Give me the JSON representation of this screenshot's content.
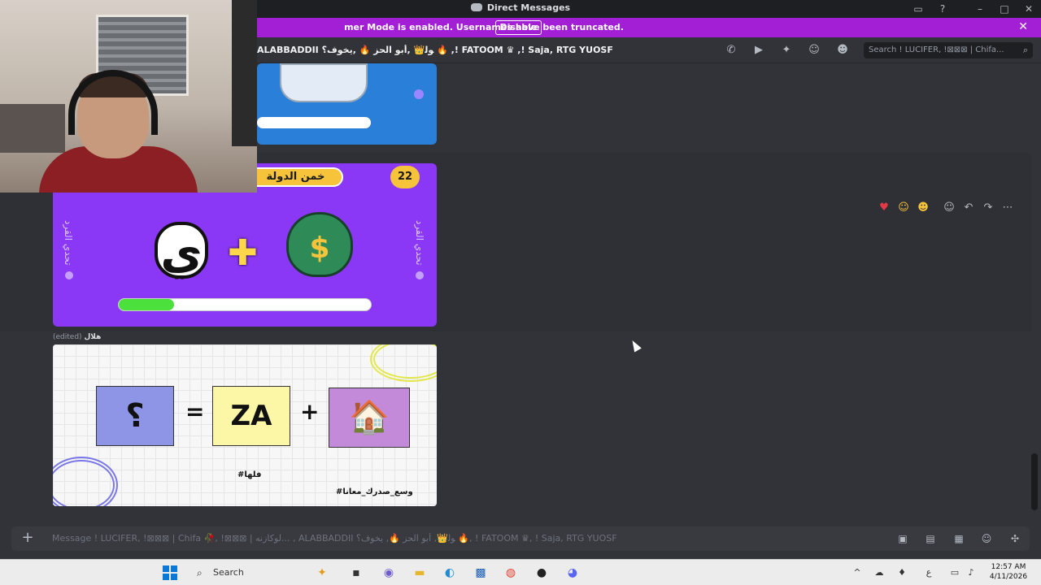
{
  "window": {
    "title": "Direct Messages"
  },
  "banner": {
    "text": "mer Mode is enabled. Usernames have been truncated.",
    "disable_label": "Disable",
    "close_glyph": "✕"
  },
  "header": {
    "names": "ALABBADDII ﻿ﻮﻟ👑 ,ﺃﺑﻮ ﺍﻟﺤﺰ 🔥 ,ﻳﺨﻮﻑ؟ 🔥 ,! FATOOM ♛ ,! Saja, RTG YUOSF",
    "search_placeholder": "Search ! LUCIFER, !⊠⊠⊠ | Chifa..."
  },
  "messages": {
    "card_purple": {
      "pill_label": "خمن الدولة",
      "number": "22",
      "side_text": "تحدي القرد",
      "glyph": "ي",
      "progress": 0.22
    },
    "edited": {
      "author": "هلال",
      "note": "(edited)"
    },
    "card_white": {
      "box_q": "؟",
      "equals": "=",
      "box_za": "ZA",
      "plus": "+",
      "house": "🏠",
      "tag1": "#فلها",
      "tag2": "#وسع_صدرك_معانا"
    }
  },
  "composer": {
    "placeholder": "Message ! LUCIFER, !⊠⊠⊠ | Chifa 🥀, !⊠⊠⊠ | ﻟﻮﻛﺎﺯﻧﻪ... , ALABBADDII ﻮﻟ👑, ﺃﺑﻮ ﺍﻟﺤﺰ 🔥, ﻳﺨﻮﻑ؟ 🔥, ! FATOOM ♛, ! Saja, RTG YUOSF"
  },
  "taskbar": {
    "search_label": "Search",
    "time": "12:57 AM",
    "date": "4/11/2026",
    "lang": "ع"
  },
  "colors": {
    "banner": "#a21fd6",
    "card_purple": "#8a38f5",
    "progress_fill": "#4be03c"
  }
}
